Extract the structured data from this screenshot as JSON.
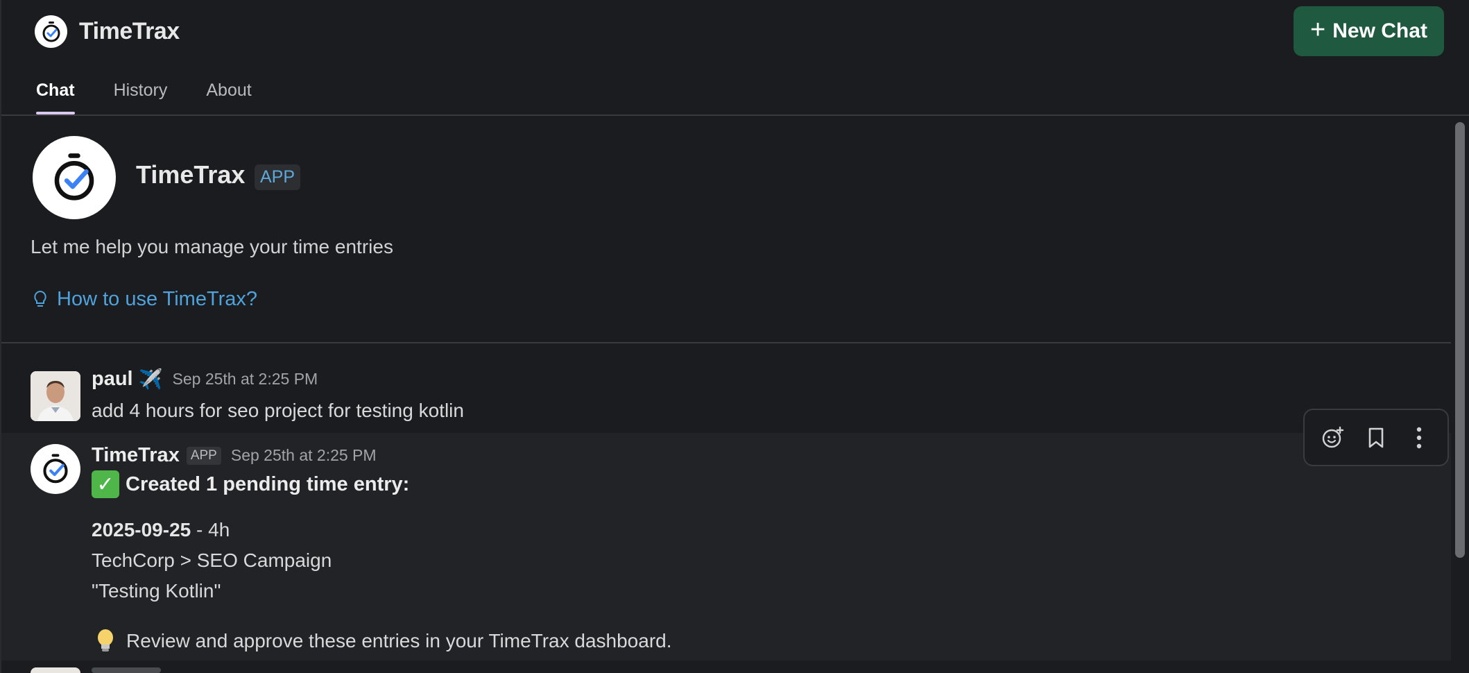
{
  "header": {
    "app_name": "TimeTrax",
    "new_chat_label": "New Chat",
    "tabs": [
      {
        "label": "Chat",
        "active": true
      },
      {
        "label": "History",
        "active": false
      },
      {
        "label": "About",
        "active": false
      }
    ]
  },
  "intro": {
    "name": "TimeTrax",
    "badge": "APP",
    "description": "Let me help you manage your time entries",
    "help_link": "How to use TimeTrax?"
  },
  "messages": [
    {
      "sender": "paul",
      "status_emoji": "✈️",
      "timestamp": "Sep 25th at 2:25 PM",
      "text": "add 4 hours for seo project for testing kotlin"
    },
    {
      "sender": "TimeTrax",
      "badge": "APP",
      "timestamp": "Sep 25th at 2:25 PM",
      "created_line": "Created 1 pending time entry:",
      "entry_date": "2025-09-25",
      "entry_duration": " - 4h",
      "entry_project": "TechCorp > SEO Campaign",
      "entry_description": "\"Testing Kotlin\"",
      "review_line": "Review and approve these entries in your TimeTrax dashboard."
    }
  ],
  "colors": {
    "background": "#1b1c1f",
    "new_chat_button": "#1f5940",
    "link": "#4ea3dc",
    "tab_indicator": "#d9c8f0"
  }
}
